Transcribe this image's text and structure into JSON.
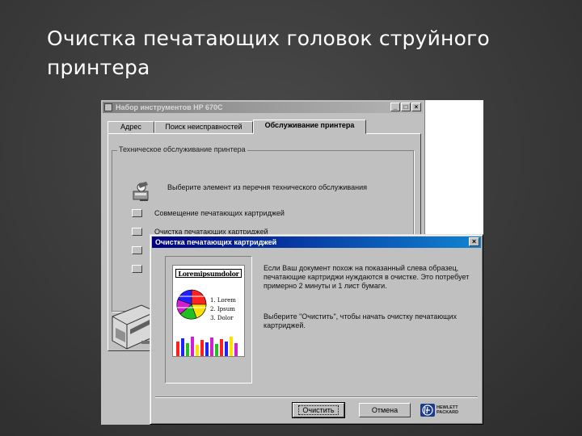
{
  "slide": {
    "title": "Очистка печатающих головок струйного принтера"
  },
  "main_window": {
    "title": "Набор инструментов HP 670C",
    "controls": [
      "_",
      "□",
      "×"
    ],
    "tabs": [
      {
        "label": "Адрес",
        "active": false
      },
      {
        "label": "Поиск неисправностей",
        "active": false
      },
      {
        "label": "Обслуживание принтера",
        "active": true
      }
    ],
    "group": {
      "label": "Техническое обслуживание принтера",
      "description": "Выберите элемент из перечня технического обслуживания",
      "options": [
        "Совмещение печатающих картриджей",
        "Очистка печатающих картриджей",
        "",
        ""
      ]
    }
  },
  "dialog": {
    "title": "Очистка печатающих картриджей",
    "close": "×",
    "sample": {
      "heading": "Loremipsumdolor",
      "list": [
        "1. Lorem",
        "2. Ipsum",
        "3. Dolor"
      ]
    },
    "text1": "Если Ваш документ похож на показанный слева образец, печатающие картриджи нуждаются в очистке. Это потребует примерно 2 минуты и 1 лист бумаги.",
    "text2": "Выберите \"Очистить\", чтобы начать очистку печатающих картриджей.",
    "buttons": {
      "clean": "Очистить",
      "cancel": "Отмена"
    },
    "logo": {
      "line1": "HEWLETT",
      "line2": "PACKARD"
    }
  },
  "colors": {
    "win_face": "#c0c0c0",
    "active_title": "#000080",
    "inactive_title": "#808080",
    "slide_bg": "#3a3a3a"
  }
}
